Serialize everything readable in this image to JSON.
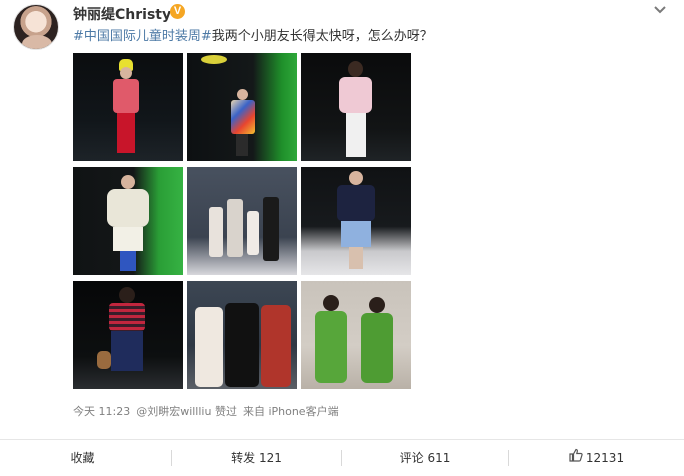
{
  "post": {
    "username": "钟丽缇Christy",
    "verified_badge": "V",
    "hashtag": "#中国国际儿童时装周#",
    "text": "我两个小朋友长得太快呀，怎么办呀？",
    "meta": {
      "time": "今天 11:23",
      "liked_by": "@刘畊宏willliu 赞过",
      "source": "来自 iPhone客户端"
    },
    "photos": [
      {
        "icon": "runway-photo"
      },
      {
        "icon": "runway-photo"
      },
      {
        "icon": "runway-photo"
      },
      {
        "icon": "runway-photo"
      },
      {
        "icon": "group-photo"
      },
      {
        "icon": "runway-photo"
      },
      {
        "icon": "runway-photo"
      },
      {
        "icon": "group-photo"
      },
      {
        "icon": "portrait-photo"
      }
    ]
  },
  "actions": {
    "favorite": "收藏",
    "repost": "转发 121",
    "comment": "评论 611",
    "like": "12131"
  },
  "colors": {
    "hashtag": "#4d7aa6",
    "verified_badge": "#f5a623",
    "meta_text": "#808080"
  }
}
